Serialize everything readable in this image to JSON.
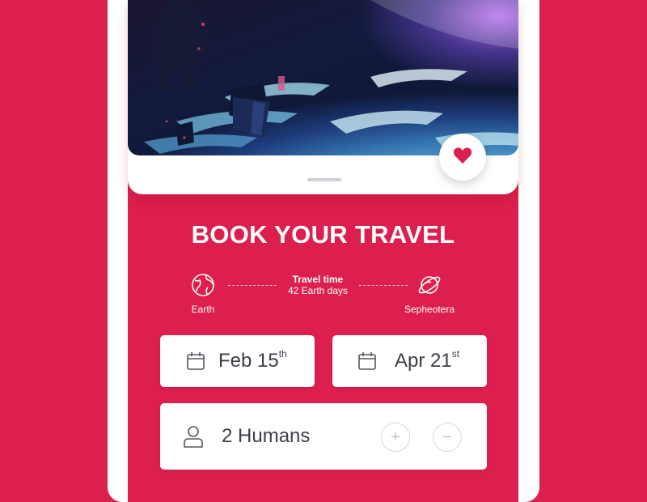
{
  "hero": {
    "image": "astronaut-over-earth"
  },
  "favorite": {
    "icon": "heart-icon",
    "color": "#dc1f4e"
  },
  "booking": {
    "title": "BOOK YOUR TRAVEL",
    "origin": {
      "label": "Earth",
      "icon": "globe-icon"
    },
    "destination": {
      "label": "Sepheotera",
      "icon": "planet-icon"
    },
    "travel_time_label": "Travel time",
    "travel_time_value": "42 Earth days",
    "departure": {
      "day": "Feb 15",
      "suffix": "th",
      "icon": "calendar-icon"
    },
    "return": {
      "day": "Apr 21",
      "suffix": "st",
      "icon": "calendar-icon"
    },
    "passengers": {
      "value": "2 Humans",
      "icon": "user-icon",
      "increment": "+",
      "decrement": "−"
    }
  },
  "colors": {
    "accent": "#dc1f4e",
    "card": "#ffffff",
    "text": "#3e3e4a"
  }
}
